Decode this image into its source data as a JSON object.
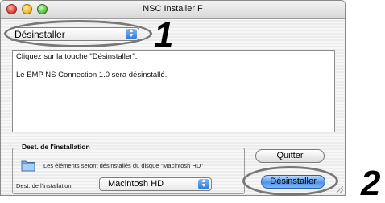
{
  "window": {
    "title": "NSC Installer F"
  },
  "mode_popup": {
    "selected": "Désinstaller"
  },
  "callouts": {
    "first": "1",
    "second": "2"
  },
  "message_panel": {
    "line1": "Cliquez sur la touche \"Désinstaller\".",
    "line2": "Le EMP NS Connection 1.0 sera désinstallé."
  },
  "destination": {
    "group_title": "Dest. de l'installation",
    "info_text": "Les éléments seront désinstallés du disque \"Macintosh HD\"",
    "field_label": "Dest. de l'installation:",
    "selected_disk": "Macintosh HD"
  },
  "buttons": {
    "quit_label": "Quitter",
    "uninstall_label": "Désinstaller"
  },
  "icons": [
    "close-icon",
    "minimize-icon",
    "zoom-icon",
    "popup-arrows-icon",
    "folder-icon",
    "resize-grip-icon"
  ],
  "colors": {
    "default_button": "#4f93e6",
    "callout_outline": "#777777"
  }
}
